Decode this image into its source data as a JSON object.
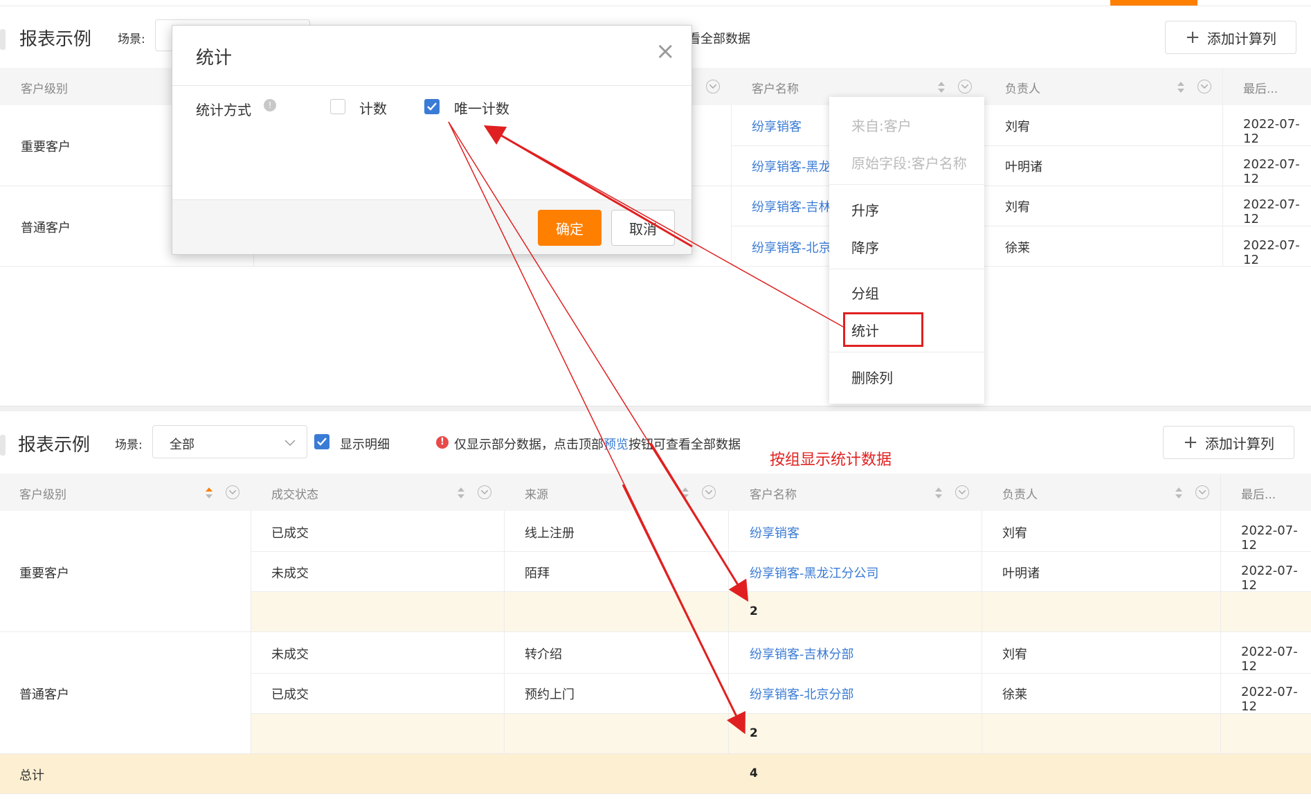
{
  "top": {
    "title": "报表示例",
    "scene_label": "场景:",
    "notice_fragment": "看全部数据",
    "add_button": "添加计算列",
    "columns": [
      "客户级别",
      "客户名称",
      "负责人",
      "最后..."
    ],
    "groups": [
      "重要客户",
      "普通客户"
    ],
    "rows": [
      {
        "name": "纷享销客",
        "owner": "刘宥",
        "date": "2022-07-12"
      },
      {
        "name": "纷享销客-黑龙",
        "owner": "叶明诸",
        "date": "2022-07-12"
      },
      {
        "name": "纷享销客-吉林",
        "owner": "刘宥",
        "date": "2022-07-12"
      },
      {
        "name": "纷享销客-北京",
        "owner": "徐莱",
        "date": "2022-07-12"
      }
    ]
  },
  "context_menu": {
    "source": "来自:客户",
    "original_field": "原始字段:客户名称",
    "asc": "升序",
    "desc": "降序",
    "group": "分组",
    "stat": "统计",
    "delete": "删除列"
  },
  "modal": {
    "title": "统计",
    "close": "×",
    "method_label": "统计方式",
    "option_count": "计数",
    "option_unique": "唯一计数",
    "option_count_checked": false,
    "option_unique_checked": true,
    "ok": "确定",
    "cancel": "取消"
  },
  "annotation": "按组显示统计数据",
  "bottom": {
    "title": "报表示例",
    "scene_label": "场景:",
    "scene_value": "全部",
    "show_detail": "显示明细",
    "notice_before": "仅显示部分数据，点击顶部",
    "notice_link": "预览",
    "notice_after": "按钮可查看全部数据",
    "add_button": "添加计算列",
    "columns": [
      "客户级别",
      "成交状态",
      "来源",
      "客户名称",
      "负责人",
      "最后..."
    ],
    "groups": [
      {
        "name": "重要客户",
        "rows": [
          {
            "status": "已成交",
            "source": "线上注册",
            "name": "纷享销客",
            "owner": "刘宥",
            "date": "2022-07-12"
          },
          {
            "status": "未成交",
            "source": "陌拜",
            "name": "纷享销客-黑龙江分公司",
            "owner": "叶明诸",
            "date": "2022-07-12"
          }
        ],
        "subtotal": "2"
      },
      {
        "name": "普通客户",
        "rows": [
          {
            "status": "未成交",
            "source": "转介绍",
            "name": "纷享销客-吉林分部",
            "owner": "刘宥",
            "date": "2022-07-12"
          },
          {
            "status": "已成交",
            "source": "预约上门",
            "name": "纷享销客-北京分部",
            "owner": "徐莱",
            "date": "2022-07-12"
          }
        ],
        "subtotal": "2"
      }
    ],
    "total_label": "总计",
    "total_value": "4"
  },
  "colors": {
    "accent": "#ff7f00",
    "link": "#3a7bd5",
    "annotation_red": "#e02020"
  }
}
